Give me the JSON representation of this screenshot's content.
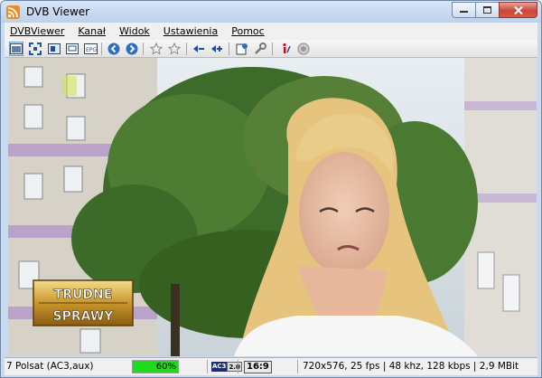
{
  "window": {
    "title": "DVB Viewer"
  },
  "menu": {
    "items": [
      "DVBViewer",
      "Kanał",
      "Widok",
      "Ustawienia",
      "Pomoc"
    ]
  },
  "toolbar": {
    "buttons": [
      "video-window-icon",
      "fullscreen-icon",
      "teletext-icon",
      "osd-icon",
      "epg-icon",
      "back-icon",
      "forward-icon",
      "favorite-icon",
      "favorite-add-icon",
      "volume-down-icon",
      "volume-up-icon",
      "recording-icon",
      "settings-icon",
      "info-icon",
      "record-icon"
    ]
  },
  "video": {
    "overlay_line1": "TRUDNE",
    "overlay_line2": "SPRAWY"
  },
  "status": {
    "channel": "7 Polsat (AC3,aux)",
    "signal": "60%",
    "signal_level": 0.6,
    "audio_badge_a": "AC3",
    "audio_badge_b": "2.0",
    "aspect": "16:9",
    "info": "720x576, 25 fps | 48 khz, 128 kbps | 2,9 MBit"
  },
  "colors": {
    "signal": "#1edb1e",
    "accent": "#2f6fbf"
  }
}
